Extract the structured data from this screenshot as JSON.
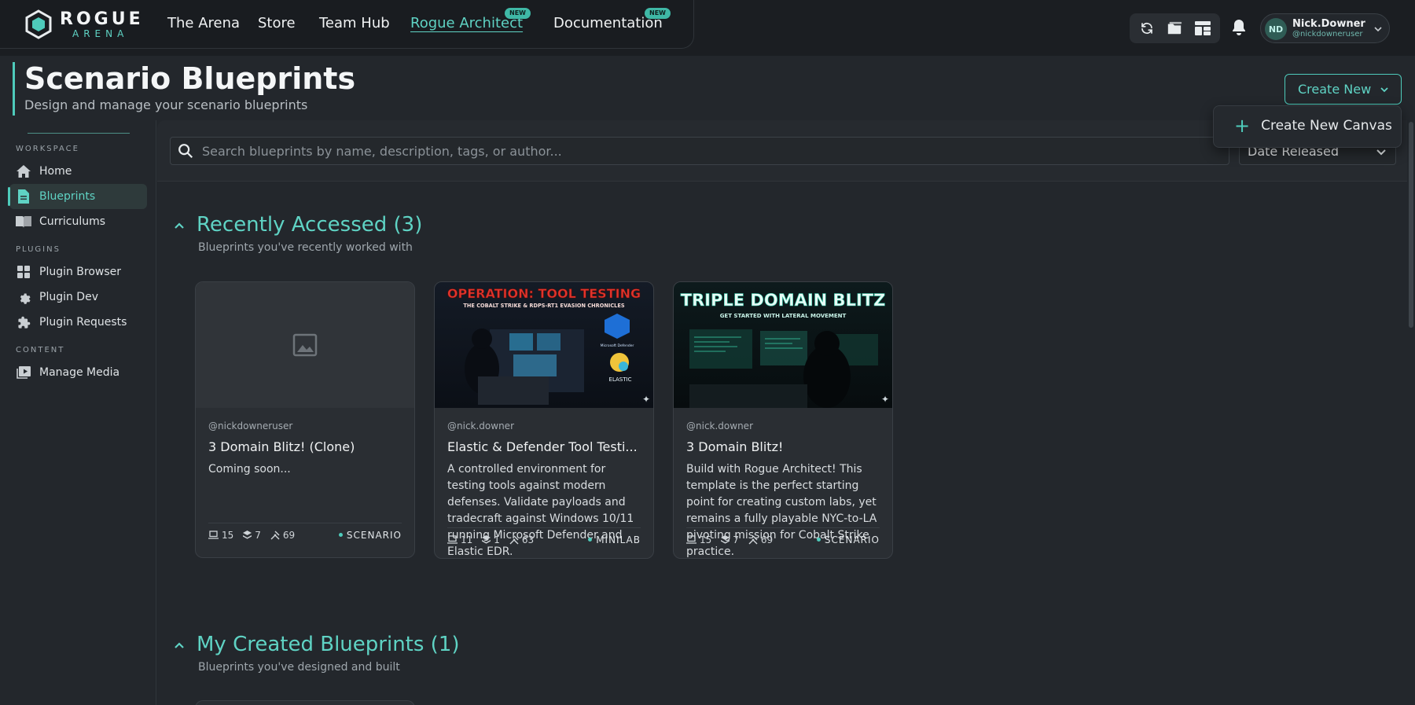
{
  "brand": {
    "name": "ROGUE",
    "sub": "ARENA"
  },
  "nav": {
    "links": [
      {
        "label": "The Arena",
        "badge": ""
      },
      {
        "label": "Store",
        "badge": ""
      },
      {
        "label": "Team Hub",
        "badge": ""
      },
      {
        "label": "Rogue Architect",
        "badge": "NEW",
        "active": true
      },
      {
        "label": "Documentation",
        "badge": "NEW"
      }
    ],
    "tools": [
      "sync-icon",
      "folder-icon",
      "layout-icon"
    ],
    "notifications_icon": "bell-icon"
  },
  "user": {
    "initials": "ND",
    "name": "Nick.Downer",
    "handle": "@nickdowneruser"
  },
  "header": {
    "title": "Scenario Blueprints",
    "subtitle": "Design and manage your scenario blueprints",
    "create_label": "Create New",
    "menu_item": "Create New Canvas"
  },
  "sidebar": {
    "sections": [
      {
        "label": "WORKSPACE",
        "items": [
          {
            "label": "Home",
            "icon": "home-icon"
          },
          {
            "label": "Blueprints",
            "icon": "document-icon",
            "active": true
          },
          {
            "label": "Curriculums",
            "icon": "book-icon"
          }
        ]
      },
      {
        "label": "PLUGINS",
        "items": [
          {
            "label": "Plugin Browser",
            "icon": "grid-icon"
          },
          {
            "label": "Plugin Dev",
            "icon": "gear-icon"
          },
          {
            "label": "Plugin Requests",
            "icon": "puzzle-icon"
          }
        ]
      },
      {
        "label": "CONTENT",
        "items": [
          {
            "label": "Manage Media",
            "icon": "media-icon"
          }
        ]
      }
    ]
  },
  "search": {
    "placeholder": "Search blueprints by name, description, tags, or author...",
    "sort": "Date Released"
  },
  "recent": {
    "title": "Recently Accessed (3)",
    "subtitle": "Blueprints you've recently worked with",
    "cards": [
      {
        "author": "@nickdowneruser",
        "title": "3 Domain Blitz! (Clone)",
        "description": "Coming soon...",
        "machines": "15",
        "layers": "7",
        "tools": "69",
        "type": "SCENARIO",
        "image": "placeholder"
      },
      {
        "author": "@nick.downer",
        "title": "Elastic & Defender Tool Testi...",
        "description": "A controlled environment for testing tools against modern defenses. Validate payloads and tradecraft against Windows 10/11 running Microsoft Defender and Elastic EDR.",
        "machines": "11",
        "layers": "1",
        "tools": "63",
        "type": "MINILAB",
        "image_title": "OPERATION: TOOL TESTING",
        "image_sub": "THE COBALT STRIKE & RDPS-RT1 EVASION CHRONICLES",
        "image_badge1": "Microsoft Defender",
        "image_badge2": "ELASTIC"
      },
      {
        "author": "@nick.downer",
        "title": "3 Domain Blitz!",
        "description": "Build with Rogue Architect! This template is the perfect starting point for creating custom labs, yet remains a fully playable NYC-to-LA pivoting mission for Cobalt Strike practice.",
        "machines": "15",
        "layers": "7",
        "tools": "69",
        "type": "SCENARIO",
        "image_title": "TRIPLE DOMAIN BLITZ",
        "image_sub": "GET STARTED WITH LATERAL MOVEMENT"
      }
    ]
  },
  "created": {
    "title": "My Created Blueprints (1)",
    "subtitle": "Blueprints you've designed and built"
  }
}
